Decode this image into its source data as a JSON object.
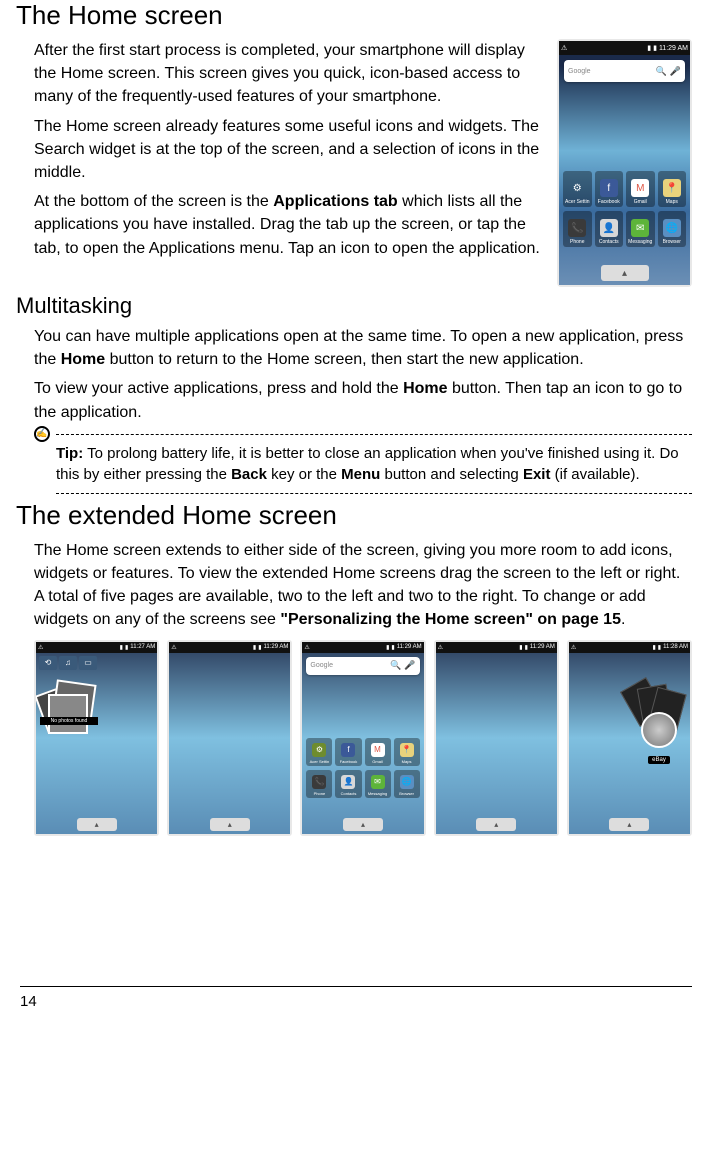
{
  "heading1": "The Home screen",
  "intro": {
    "para1": "After the first start process is completed, your smartphone will display the Home screen. This screen gives you quick, icon-based access to many of the frequently-used features of your smartphone.",
    "para2": "The Home screen already features some useful icons and widgets. The Search widget is at the top of the screen, and a selection of icons in the middle.",
    "para3a": "At the bottom of the screen is the ",
    "para3_bold": "Applications tab",
    "para3b": " which lists all the applications you have installed. Drag the tab up the screen, or tap the tab, to open the Applications menu. Tap an icon to open the application."
  },
  "heading2": "Multitasking",
  "multi": {
    "para1a": "You can have multiple applications open at the same time. To open a new application, press the ",
    "para1_bold": "Home",
    "para1b": " button to return to the Home screen, then start the new application.",
    "para2a": "To view your active applications, press and hold the ",
    "para2_bold": "Home",
    "para2b": " button. Then tap an icon to go to the application."
  },
  "tip": {
    "label": "Tip:",
    "text_a": " To prolong battery life, it is better to close an application when you've finished using it. Do this by either pressing the ",
    "bold_back": "Back",
    "text_b": " key or the ",
    "bold_menu": "Menu",
    "text_c": " button and selecting ",
    "bold_exit": "Exit",
    "text_d": " (if available)."
  },
  "heading3": "The extended Home screen",
  "extended": {
    "para_a": "The Home screen extends to either side of the screen, giving you more room to add icons, widgets or features. To view the extended Home screens drag the screen to the left or right. A total of five pages are available, two to the left and two to the right. To change or add widgets on any of the screens see ",
    "bold_ref": "\"Personalizing the Home screen\" on page 15",
    "para_b": "."
  },
  "main_phone": {
    "time": "11:29 AM",
    "search_placeholder": "Google",
    "app_row1": [
      {
        "label": "Acer Settin",
        "bg": "#6e8c2e",
        "glyph": "⚙"
      },
      {
        "label": "Facebook",
        "bg": "#3b5998",
        "glyph": "f"
      },
      {
        "label": "Gmail",
        "bg": "#ffffff",
        "glyph": "M",
        "color": "#d54"
      },
      {
        "label": "Maps",
        "bg": "#e8d27c",
        "glyph": "📍"
      }
    ],
    "app_row2": [
      {
        "label": "Phone",
        "bg": "#3a3a3a",
        "glyph": "📞"
      },
      {
        "label": "Contacts",
        "bg": "#d8d8d8",
        "glyph": "👤",
        "color": "#666"
      },
      {
        "label": "Messaging",
        "bg": "#5db43a",
        "glyph": "✉"
      },
      {
        "label": "Browser",
        "bg": "#5a8fc2",
        "glyph": "🌐"
      }
    ]
  },
  "thumbs": [
    {
      "time": "11:27 AM",
      "variant": "photos",
      "no_photos": "No photos found"
    },
    {
      "time": "11:29 AM",
      "variant": "blank"
    },
    {
      "time": "11:29 AM",
      "variant": "main"
    },
    {
      "time": "11:29 AM",
      "variant": "blank"
    },
    {
      "time": "11:28 AM",
      "variant": "ebay",
      "label": "eBay"
    }
  ],
  "page_number": "14"
}
